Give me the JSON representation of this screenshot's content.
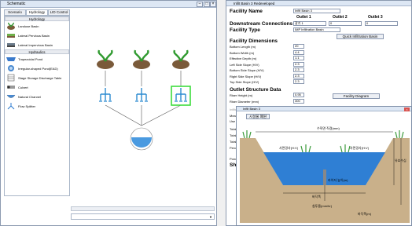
{
  "schematic": {
    "title": "Schematic",
    "tabs": [
      "Scenario",
      "Hydrology",
      "LID Control"
    ],
    "sections": {
      "hydrology": "Hydrology",
      "hydraulics": "Hydraulics"
    },
    "hydrology_items": [
      "Landuse Basin",
      "Lateral Pervious Basin",
      "Lateral Impervious Basin"
    ],
    "hydraulics_items": [
      "Trapezoidal Pond",
      "Irregular-shaped Pond(EAD)",
      "Stage Storage Discharge Table",
      "Culvert",
      "Natural Channel",
      "Flow Splitter"
    ]
  },
  "editor": {
    "title": "Infilt Basin 3 Redeveloped",
    "facility_name_label": "Facility Name",
    "facility_name_value": "Infilt Basin 3",
    "outlets": [
      "Outlet 1",
      "Outlet 2",
      "Outlet 3"
    ],
    "downstream_label": "Downstream Connections",
    "downstream_values": [
      "갈기 1",
      "0",
      "0"
    ],
    "facility_type_label": "Facility Type",
    "facility_type_value": "IMP Infiltration Basin",
    "quick_button": "Quick Infiltration Basin",
    "dimensions_label": "Facility Dimensions",
    "dimension_rows": [
      {
        "label": "Bottom Length (m)",
        "value": "20"
      },
      {
        "label": "Bottom Width (m)",
        "value": "4.4"
      },
      {
        "label": "Effective Depth (m)",
        "value": "1.1"
      },
      {
        "label": "Left Side Slope (H/V)",
        "value": "2.3"
      },
      {
        "label": "Bottom Side Slope (H/V)",
        "value": "2.3"
      },
      {
        "label": "Right Side Slope (H/V)",
        "value": "2.3"
      },
      {
        "label": "Top Side Slope (H/V)",
        "value": "2.3"
      }
    ],
    "outlet_label": "Outlet Structure Data",
    "riser_height_label": "Riser Height (m)",
    "riser_height_value": "0.95",
    "riser_diameter_label": "Riser Diameter (mm)",
    "riser_diameter_value": "300",
    "facility_diagram_button": "Facility Diagram",
    "infiltration_label": "Infiltration",
    "measured_rate_label": "Measured Infiltration Rate (mm/hr)",
    "measured_rate_value": "6",
    "wetted_area_label": "Use Wetted Surface Area (sidewalls)",
    "wetted_area_value": "NO",
    "total_volume_rows": [
      "Total Volume Infilt",
      "Total Volume Thro",
      "Total Volume Thro",
      "Percent Infiltrated"
    ],
    "pond_volume_label": "Pond Volume at Ri",
    "show_facility_label": "Show Facility"
  },
  "popup": {
    "title": "Infilt Basin 3",
    "button": "시설물 폐원",
    "diagram_labels": {
      "width_top": "수직면 직경(mm)",
      "left_slope": "사면경사(H:V)",
      "right_slope": "사면경사(H:V)",
      "depth": "유효수심",
      "bottom": "바닥폭",
      "riser": "라이저 높이(m)",
      "infil": "침투율(mm/hr)",
      "outer": "바닥폭(m)"
    }
  }
}
